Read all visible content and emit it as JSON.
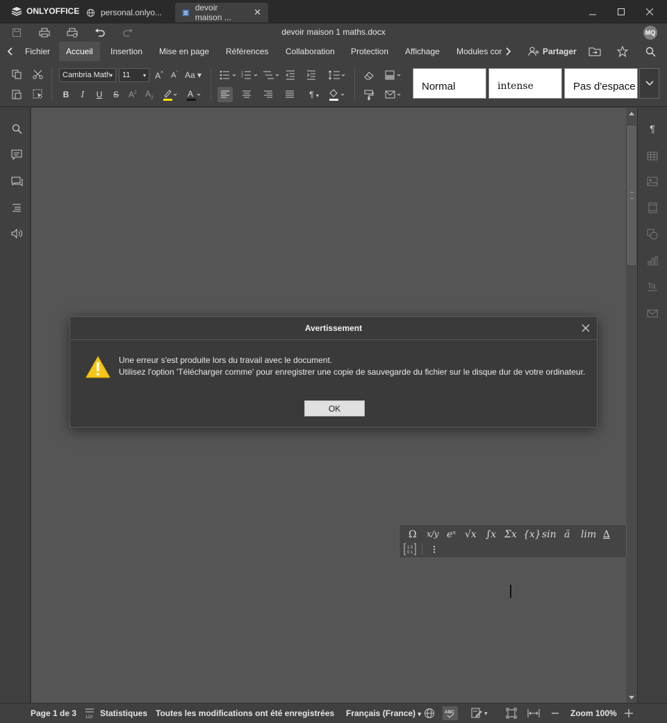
{
  "titlebar": {
    "brand": "ONLYOFFICE",
    "tabs": [
      {
        "label": "personal.onlyo..."
      },
      {
        "label": "devoir maison ..."
      }
    ],
    "window_buttons": [
      "minimize",
      "maximize",
      "close"
    ]
  },
  "quickbar": {
    "doc_title": "devoir maison 1 maths.docx",
    "avatar_initials": "MQ"
  },
  "menubar": {
    "items": [
      "Fichier",
      "Accueil",
      "Insertion",
      "Mise en page",
      "Références",
      "Collaboration",
      "Protection",
      "Affichage",
      "Modules cor"
    ],
    "active": "Accueil",
    "share_label": "Partager"
  },
  "toolbar": {
    "font_name": "Cambria Math",
    "font_size": "11",
    "styles": [
      "Normal",
      "intense",
      "Pas d'espace"
    ]
  },
  "equation_toolbar": {
    "items": [
      "Ω",
      "x/y",
      "eˣ",
      "√x",
      "∫x",
      "Σx",
      "{x}",
      "sin",
      "ä",
      "lim",
      "∆"
    ]
  },
  "dialog": {
    "title": "Avertissement",
    "line1": "Une erreur s'est produite lors du travail avec le document.",
    "line2": "Utilisez l'option 'Télécharger comme' pour enregistrer une copie de sauvegarde du fichier sur le disque dur de votre ordinateur.",
    "ok_label": "OK"
  },
  "statusbar": {
    "page": "Page 1 de 3",
    "stats": "Statistiques",
    "saved": "Toutes les modifications ont été enregistrées",
    "language": "Français (France)",
    "zoom": "Zoom 100%"
  },
  "colors": {
    "accent_warning": "#f5c518",
    "canvas_bg": "#555555",
    "chrome_bg": "#404040"
  }
}
